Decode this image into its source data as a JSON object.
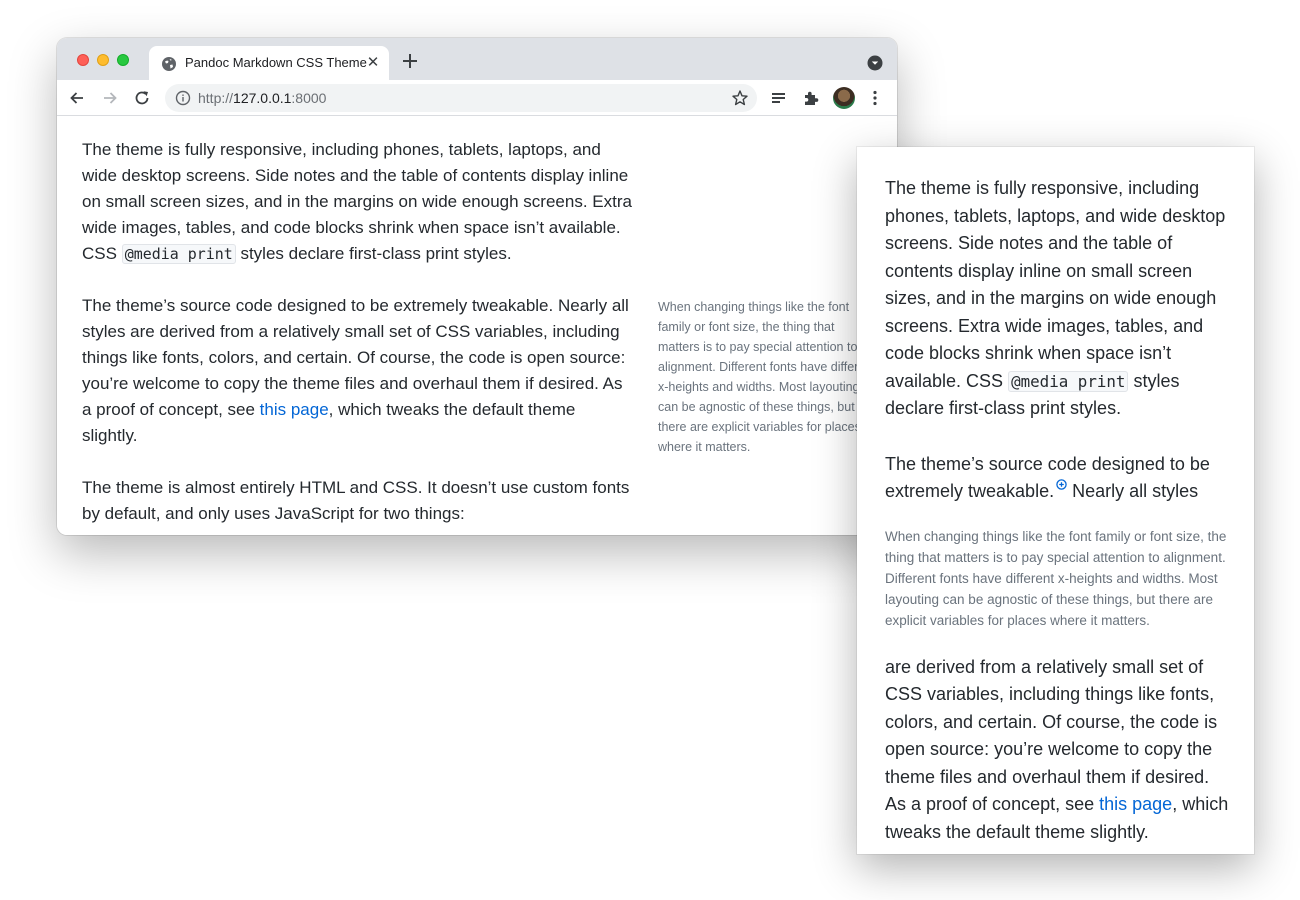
{
  "browser": {
    "tab_title": "Pandoc Markdown CSS Theme",
    "tab_close": "✕",
    "url": {
      "scheme": "http://",
      "host": "127.0.0.1",
      "port": ":8000"
    }
  },
  "content": {
    "p1": {
      "before_code": "The theme is fully responsive, including phones, tablets, laptops, and wide desktop screens. Side notes and the table of contents display inline on small screen sizes, and in the margins on wide enough screens. Extra wide images, tables, and code blocks shrink when space isn’t available. CSS ",
      "code": "@media print",
      "after_code": " styles declare first-class print styles."
    },
    "p2": {
      "part1": "The theme’s source code designed to be extremely tweakable.",
      "part2": " Nearly all styles are derived from a relatively small set of CSS variables, including things like fonts, colors, and certain. Of course, the code is open source: you’re welcome to copy the theme files and overhaul them if desired. As a proof of concept, see ",
      "link": "this page",
      "after_link": ", which tweaks the default theme slightly."
    },
    "p3": "The theme is almost entirely HTML and CSS. It doesn’t use custom fonts by default, and only uses JavaScript for two things:",
    "sidenote": "When changing things like the font family or font size, the thing that matters is to pay special attention to alignment. Different fonts have different x-heights and widths. Most layouting can be agnostic of these things, but there are explicit variables for places where it matters."
  },
  "phone": {
    "p2_lead": "The theme’s source code designed to be extremely tweakable.",
    "p2_tail_start": " Nearly all styles",
    "p2_continued": "are derived from a relatively small set of CSS variables, including things like fonts, colors, and certain. Of course, the code is open source: you’re welcome to copy the theme files and overhaul them if desired. As a proof of concept, see ",
    "p2_after_link": ", which tweaks the default theme slightly."
  },
  "colors": {
    "text": "#24292e",
    "muted": "#6a737d",
    "link": "#0366d6",
    "tabstrip": "#dee1e6"
  },
  "icons": [
    "globe-icon",
    "close-icon",
    "plus-icon",
    "tab-search-icon",
    "back-arrow-icon",
    "forward-arrow-icon",
    "reload-icon",
    "info-icon",
    "star-icon",
    "reading-list-icon",
    "extensions-icon",
    "more-vert-icon",
    "sidenote-marker-icon"
  ]
}
